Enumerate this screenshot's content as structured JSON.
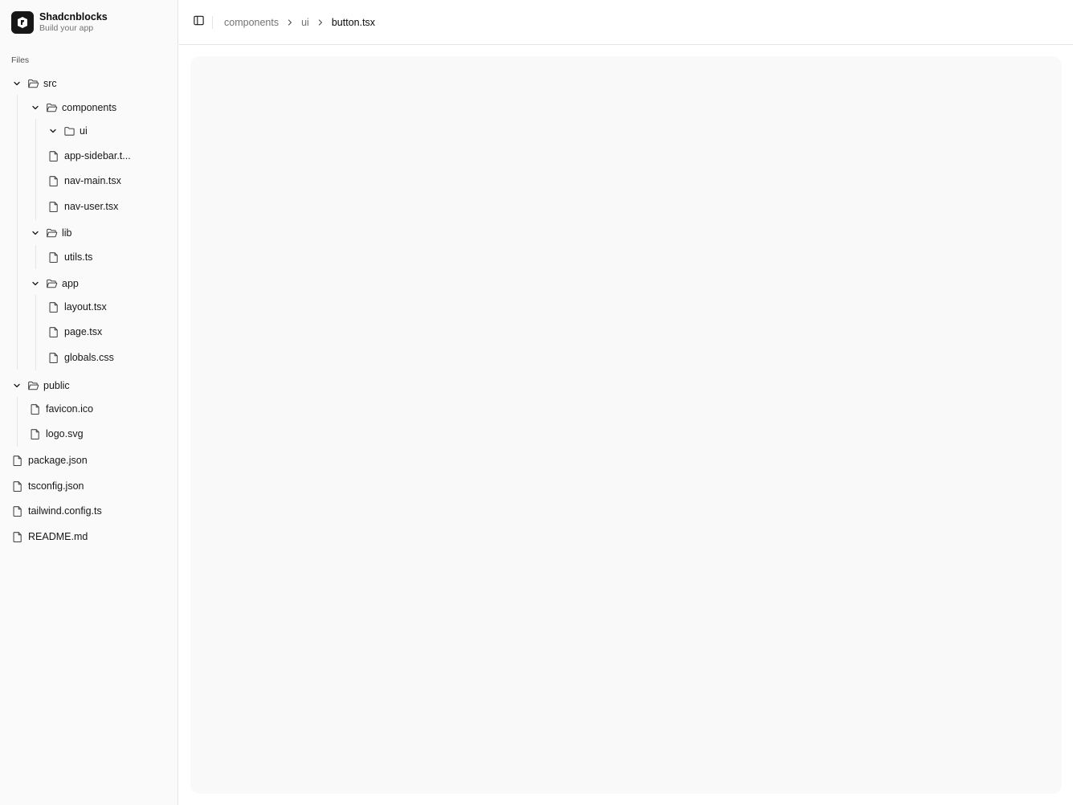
{
  "brand": {
    "name": "Shadcnblocks",
    "subtitle": "Build your app"
  },
  "sidebar": {
    "group_label": "Files",
    "tree": {
      "src": "src",
      "components": "components",
      "ui": "ui",
      "app_sidebar": "app-sidebar.t...",
      "nav_main": "nav-main.tsx",
      "nav_user": "nav-user.tsx",
      "lib": "lib",
      "utils": "utils.ts",
      "app": "app",
      "layout": "layout.tsx",
      "page": "page.tsx",
      "globals": "globals.css",
      "public": "public",
      "favicon": "favicon.ico",
      "logo_svg": "logo.svg",
      "package_json": "package.json",
      "tsconfig": "tsconfig.json",
      "tailwind": "tailwind.config.ts",
      "readme": "README.md"
    }
  },
  "breadcrumb": {
    "items": [
      "components",
      "ui"
    ],
    "current": "button.tsx"
  },
  "icons": {
    "logo": "logo-icon",
    "folder_open": "folder-open-icon",
    "folder": "folder-icon",
    "file": "file-icon",
    "chevron_down": "chevron-down-icon",
    "chevron_right": "chevron-right-icon",
    "sidebar_toggle": "panel-left-icon"
  }
}
